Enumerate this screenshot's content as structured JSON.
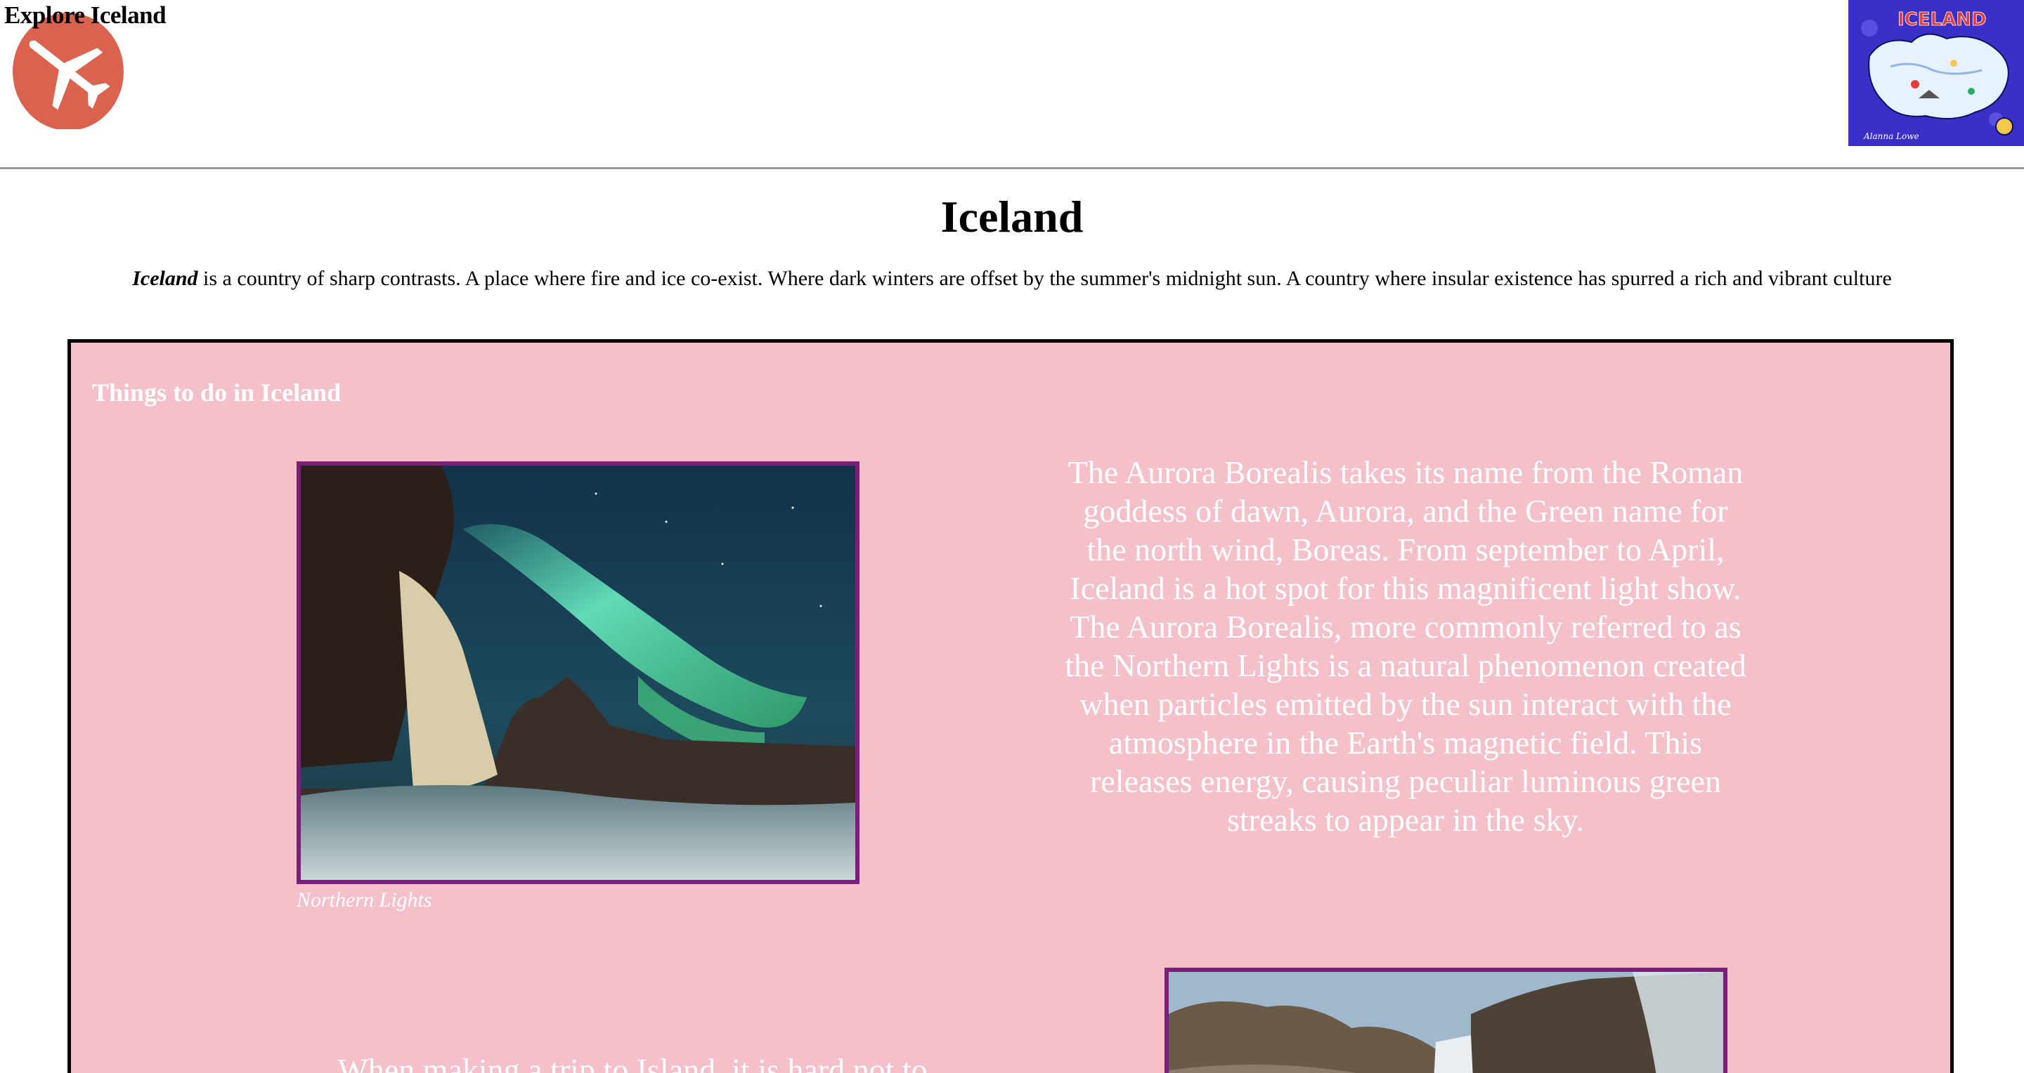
{
  "header": {
    "site_title": "Explore Iceland",
    "map_label": "ICELAND",
    "map_signature": "Alanna Lowe"
  },
  "main": {
    "heading": "Iceland",
    "intro": {
      "country": "Iceland",
      "text": " is a country of sharp contrasts. A place where fire and ice co-exist. Where dark winters are offset by the summer's midnight sun. A country where insular existence has spurred a rich and vibrant culture"
    }
  },
  "things_to_do": {
    "title": "Things to do in Iceland",
    "aurora": {
      "caption": "Northern Lights",
      "paragraph_1": "The Aurora Borealis takes its name from the Roman goddess of dawn, Aurora, and the Green name for the north wind, Boreas. From september to April, Iceland is a hot spot for this magnificent light show.",
      "paragraph_2": "The Aurora Borealis, more commonly referred to as the Northern Lights is a natural phenomenon created when particles emitted by the sun interact with the atmosphere in the Earth's magnetic field. This releases energy, causing peculiar luminous green streaks to appear in the sky."
    },
    "trip_text": "When making a trip to Island, it is hard not to"
  },
  "colors": {
    "panel_background": "#f4c1cb",
    "photo_border": "#7b1f7b",
    "logo_red": "#d9634e",
    "map_blue": "#3b2fc7"
  },
  "icons": {
    "logo": "airplane-icon",
    "map": "iceland-map-illustration"
  }
}
